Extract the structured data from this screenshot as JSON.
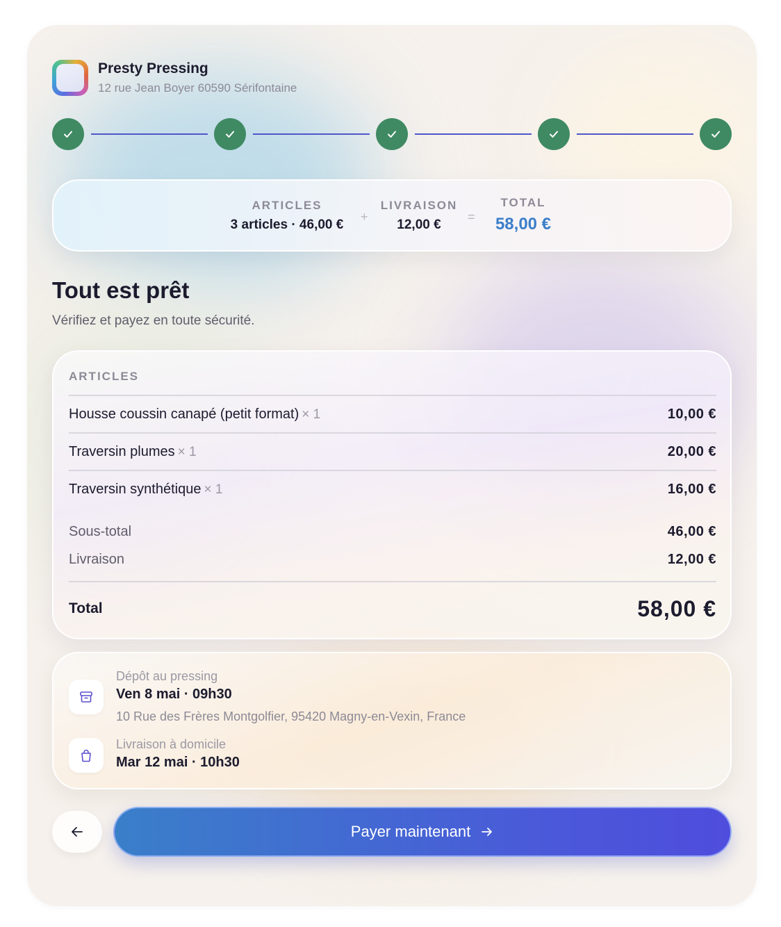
{
  "shop": {
    "name": "Presty Pressing",
    "address": "12 rue Jean Boyer 60590 Sérifontaine"
  },
  "stepper": {
    "total_steps": 5,
    "completed_steps": 5,
    "accent_color": "#3f8a63"
  },
  "summary": {
    "articles_label": "ARTICLES",
    "articles_value": "3 articles · 46,00 €",
    "plus": "+",
    "delivery_label": "LIVRAISON",
    "delivery_value": "12,00 €",
    "equals": "=",
    "total_label": "TOTAL",
    "total_value": "58,00 €"
  },
  "heading": {
    "title": "Tout est prêt",
    "subtitle": "Vérifiez et payez en toute sécurité."
  },
  "articles": {
    "section_label": "ARTICLES",
    "items": [
      {
        "name": "Housse coussin canapé (petit format)",
        "qty": "× 1",
        "price": "10,00 €"
      },
      {
        "name": "Traversin plumes",
        "qty": "× 1",
        "price": "20,00 €"
      },
      {
        "name": "Traversin synthétique",
        "qty": "× 1",
        "price": "16,00 €"
      }
    ],
    "subtotal_label": "Sous-total",
    "subtotal_value": "46,00 €",
    "delivery_label": "Livraison",
    "delivery_value": "12,00 €",
    "total_label": "Total",
    "total_value": "58,00 €"
  },
  "delivery": {
    "dropoff": {
      "icon": "archive-box-icon",
      "kind": "Dépôt au pressing",
      "when": "Ven 8 mai · 09h30",
      "address": "10 Rue des Frères Montgolfier, 95420 Magny-en-Vexin, France"
    },
    "home": {
      "icon": "shopping-bag-icon",
      "kind": "Livraison à domicile",
      "when": "Mar 12 mai · 10h30"
    }
  },
  "actions": {
    "back_icon": "arrow-left-icon",
    "pay_label": "Payer maintenant",
    "pay_icon": "arrow-right-icon"
  }
}
